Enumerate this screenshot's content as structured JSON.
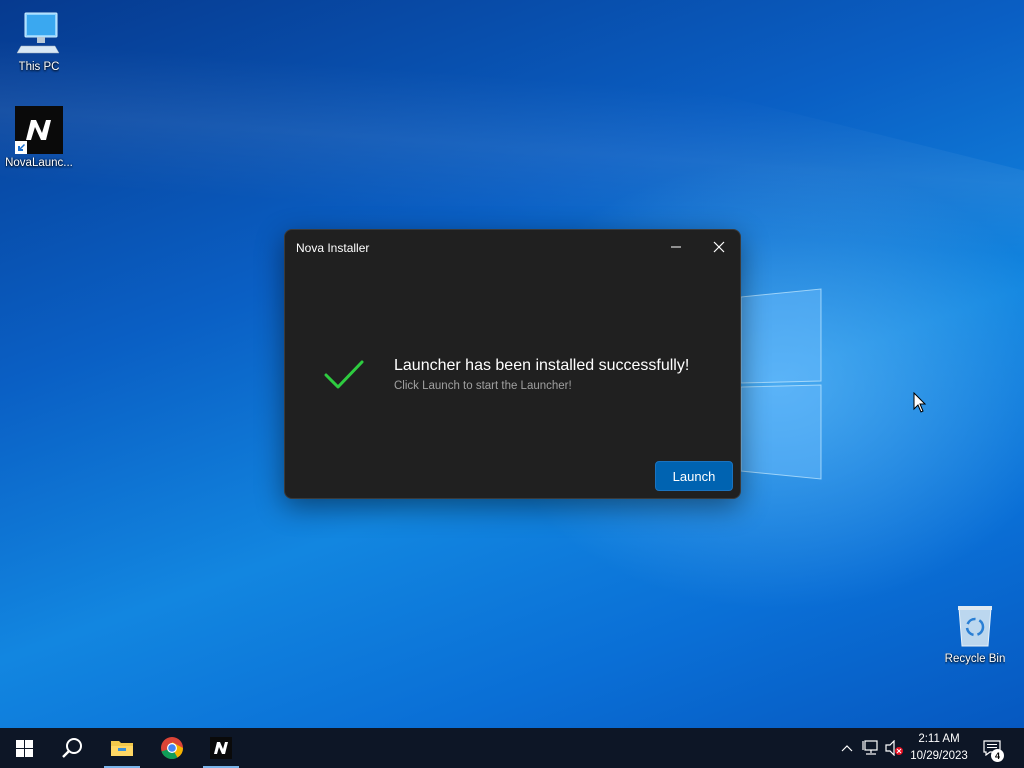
{
  "desktop": {
    "icons": [
      {
        "label": "This PC",
        "icon": "computer-icon"
      },
      {
        "label": "NovaLaunc...",
        "icon": "nova-launcher-icon"
      },
      {
        "label": "Recycle Bin",
        "icon": "recycle-bin-icon"
      }
    ]
  },
  "installer": {
    "title": "Nova Installer",
    "message_title": "Launcher has been installed successfully!",
    "message_subtitle": "Click Launch to start the Launcher!",
    "launch_label": "Launch",
    "colors": {
      "check": "#2ecc40",
      "button": "#0063b1",
      "window": "#202020"
    }
  },
  "taskbar": {
    "pinned": [
      {
        "name": "start",
        "icon": "windows-icon"
      },
      {
        "name": "search",
        "icon": "search-icon"
      },
      {
        "name": "file-explorer",
        "icon": "folder-icon"
      },
      {
        "name": "chrome",
        "icon": "chrome-icon"
      },
      {
        "name": "nova-launcher",
        "icon": "nova-launcher-icon"
      }
    ],
    "clock": {
      "time": "2:11 AM",
      "date": "10/29/2023"
    },
    "notification_count": "4"
  }
}
